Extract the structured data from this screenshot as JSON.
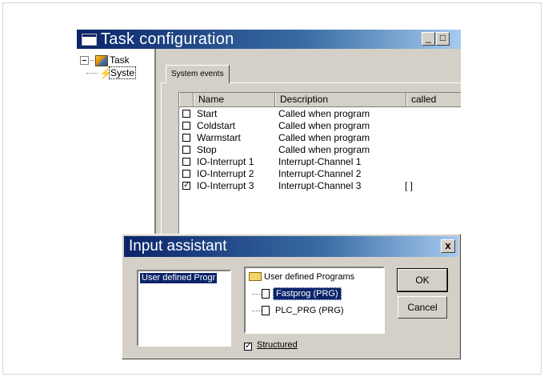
{
  "task_window": {
    "title": "Task configuration",
    "min_glyph": "_",
    "max_glyph": "□",
    "tree": {
      "root_label": "Task",
      "child_label": "Syste"
    },
    "tab_label": "System events",
    "columns": [
      "Name",
      "Description",
      "called"
    ],
    "rows": [
      {
        "checked": false,
        "name": "Start",
        "description": "Called when program",
        "called": ""
      },
      {
        "checked": false,
        "name": "Coldstart",
        "description": "Called when program",
        "called": ""
      },
      {
        "checked": false,
        "name": "Warmstart",
        "description": "Called when program",
        "called": ""
      },
      {
        "checked": false,
        "name": "Stop",
        "description": "Called when program",
        "called": ""
      },
      {
        "checked": false,
        "name": "IO-Interrupt 1",
        "description": "Interrupt-Channel 1",
        "called": ""
      },
      {
        "checked": false,
        "name": "IO-Interrupt 2",
        "description": "Interrupt-Channel 2",
        "called": ""
      },
      {
        "checked": true,
        "name": "IO-Interrupt 3",
        "description": "Interrupt-Channel 3",
        "called": "[           ]"
      }
    ]
  },
  "input_assistant": {
    "title": "Input assistant",
    "close_glyph": "x",
    "category_item": "User defined Progr",
    "tree_root": "User defined Programs",
    "tree_items": [
      {
        "label": "Fastprog (PRG)",
        "selected": true
      },
      {
        "label": "PLC_PRG (PRG)",
        "selected": false
      }
    ],
    "ok_label": "OK",
    "cancel_label": "Cancel",
    "structured_label": "Structured",
    "structured_checked": true
  }
}
